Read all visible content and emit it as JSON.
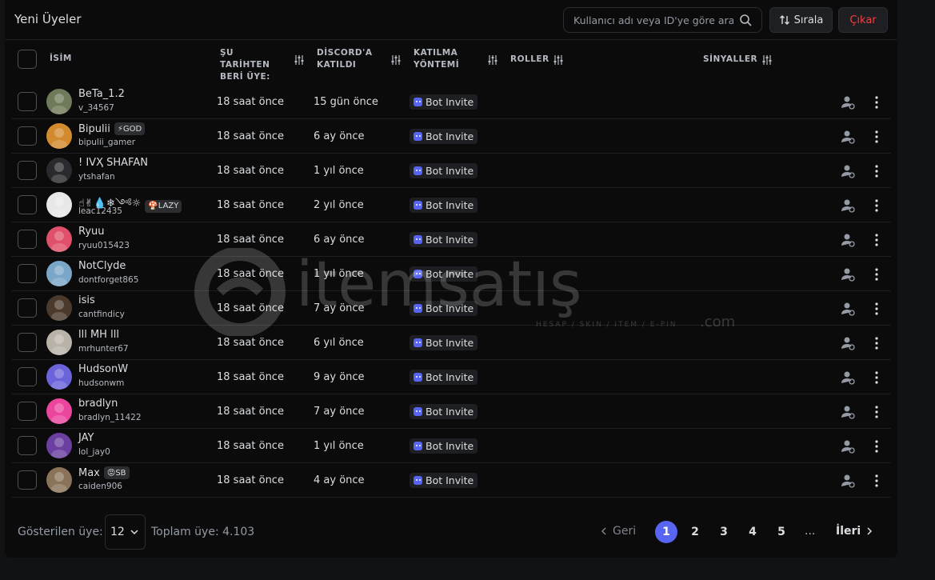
{
  "header": {
    "title": "Yeni Üyeler",
    "search_placeholder": "Kullanıcı adı veya ID'ye göre ara",
    "sort_label": "Sırala",
    "kick_label": "Çıkar"
  },
  "columns": {
    "name": "İSİM",
    "member_since": "ŞU TARİHTEN BERİ ÜYE:",
    "joined_discord": "DİSCORD'A KATILDI",
    "join_method": "KATILMA YÖNTEMİ",
    "roles": "ROLLER",
    "signals": "SİNYALLER"
  },
  "members": [
    {
      "name": "BeTa_1.2",
      "username": "v_34567",
      "member_since": "18 saat önce",
      "joined_discord": "15 gün önce",
      "method": "Bot Invite",
      "tag": "",
      "avatar_color": "#6f7a5a"
    },
    {
      "name": "Bipulii",
      "username": "bipulii_gamer",
      "member_since": "18 saat önce",
      "joined_discord": "6 ay önce",
      "method": "Bot Invite",
      "tag": "⚡GOD",
      "avatar_color": "#d28a2e"
    },
    {
      "name": "! IVҲ SHAFAN",
      "username": "ytshafan",
      "member_since": "18 saat önce",
      "joined_discord": "1 yıl önce",
      "method": "Bot Invite",
      "tag": "",
      "avatar_color": "#2a2a2e"
    },
    {
      "name": "☝✌💧❄༺☼",
      "username": "leac12435",
      "member_since": "18 saat önce",
      "joined_discord": "2 yıl önce",
      "method": "Bot Invite",
      "tag": "🍄LAZY",
      "avatar_color": "#e8e8e8"
    },
    {
      "name": "Ryuu",
      "username": "ryuu015423",
      "member_since": "18 saat önce",
      "joined_discord": "6 ay önce",
      "method": "Bot Invite",
      "tag": "",
      "avatar_color": "#e0506a"
    },
    {
      "name": "NotClyde",
      "username": "dontforget865",
      "member_since": "18 saat önce",
      "joined_discord": "1 yıl önce",
      "method": "Bot Invite",
      "tag": "",
      "avatar_color": "#7aa7c8"
    },
    {
      "name": "isis",
      "username": "cantfindicy",
      "member_since": "18 saat önce",
      "joined_discord": "7 ay önce",
      "method": "Bot Invite",
      "tag": "",
      "avatar_color": "#4b3a2c"
    },
    {
      "name": "lll MH lll",
      "username": "mrhunter67",
      "member_since": "18 saat önce",
      "joined_discord": "6 yıl önce",
      "method": "Bot Invite",
      "tag": "",
      "avatar_color": "#b9b2a8"
    },
    {
      "name": "HudsonW",
      "username": "hudsonwm",
      "member_since": "18 saat önce",
      "joined_discord": "9 ay önce",
      "method": "Bot Invite",
      "tag": "",
      "avatar_color": "#6b63d9"
    },
    {
      "name": "bradlyn",
      "username": "bradlyn_11422",
      "member_since": "18 saat önce",
      "joined_discord": "7 ay önce",
      "method": "Bot Invite",
      "tag": "",
      "avatar_color": "#eb459e"
    },
    {
      "name": "JAY",
      "username": "lol_jay0",
      "member_since": "18 saat önce",
      "joined_discord": "1 yıl önce",
      "method": "Bot Invite",
      "tag": "",
      "avatar_color": "#6a3fa0"
    },
    {
      "name": "Max",
      "username": "caiden906",
      "member_since": "18 saat önce",
      "joined_discord": "4 ay önce",
      "method": "Bot Invite",
      "tag": "😡SB",
      "avatar_color": "#8a7358"
    }
  ],
  "footer": {
    "shown_label": "Gösterilen üye:",
    "per_page": "12",
    "total": "Toplam üye: 4.103",
    "prev": "Geri",
    "next": "İleri",
    "pages": [
      "1",
      "2",
      "3",
      "4",
      "5"
    ],
    "active_page": "1",
    "ellipsis": "..."
  },
  "watermark": {
    "brand": "itemsatış",
    "tagline": "HESAP / SKIN / ITEM / E-PIN",
    "suffix": ".com"
  },
  "colors": {
    "accent": "#5865f2",
    "danger": "#f23f42",
    "background": "#0b0b0c"
  }
}
